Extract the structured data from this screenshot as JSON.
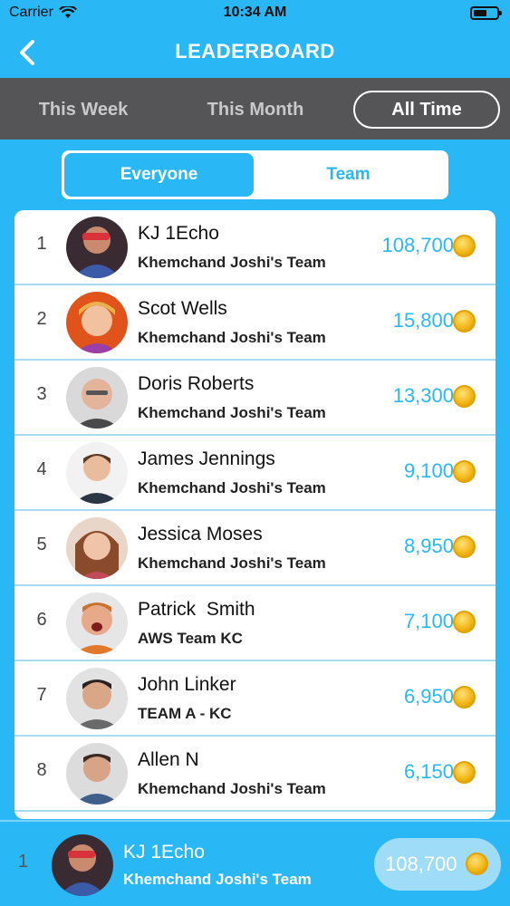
{
  "status": {
    "carrier": "Carrier",
    "time": "10:34 AM"
  },
  "nav": {
    "title": "LEADERBOARD"
  },
  "period_tabs": [
    {
      "label": "This Week"
    },
    {
      "label": "This Month"
    },
    {
      "label": "All Time",
      "selected": true
    }
  ],
  "segment": [
    {
      "label": "Everyone",
      "selected": true
    },
    {
      "label": "Team"
    }
  ],
  "leaderboard": [
    {
      "rank": "1",
      "name": "KJ 1Echo",
      "team": "Khemchand Joshi's Team",
      "points": "108,700"
    },
    {
      "rank": "2",
      "name": "Scot Wells",
      "team": "Khemchand Joshi's Team",
      "points": "15,800"
    },
    {
      "rank": "3",
      "name": "Doris Roberts",
      "team": "Khemchand Joshi's Team",
      "points": "13,300"
    },
    {
      "rank": "4",
      "name": "James Jennings",
      "team": "Khemchand Joshi's Team",
      "points": "9,100"
    },
    {
      "rank": "5",
      "name": "Jessica Moses",
      "team": "Khemchand Joshi's Team",
      "points": "8,950"
    },
    {
      "rank": "6",
      "name": "Patrick  Smith",
      "team": "AWS Team KC",
      "points": "7,100"
    },
    {
      "rank": "7",
      "name": "John Linker",
      "team": "TEAM A - KC",
      "points": "6,950"
    },
    {
      "rank": "8",
      "name": "Allen N",
      "team": "Khemchand Joshi's Team",
      "points": "6,150"
    }
  ],
  "current_user": {
    "rank": "1",
    "name": "KJ 1Echo",
    "team": "Khemchand Joshi's Team",
    "points": "108,700"
  },
  "colors": {
    "accent": "#29b8f5",
    "tab_bar": "#555557",
    "coin": "#f2b410"
  },
  "icons": {
    "back": "chevron-left-icon",
    "coin": "coin-icon",
    "wifi": "wifi-icon",
    "battery": "battery-icon"
  }
}
